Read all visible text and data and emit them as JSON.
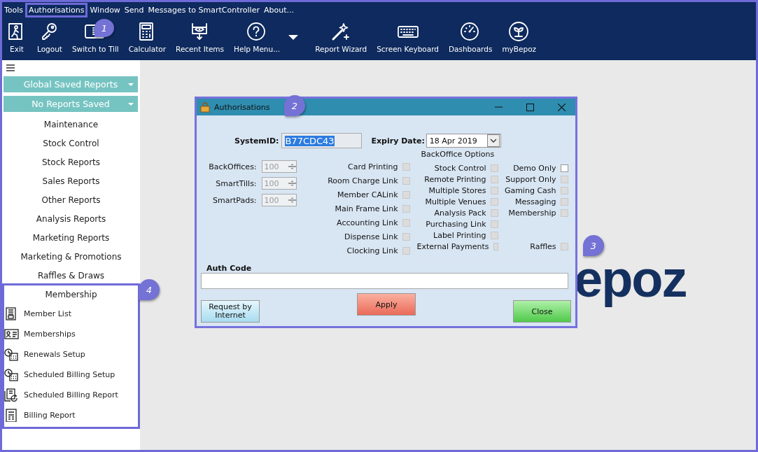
{
  "menu_bar": [
    {
      "label": "Tools",
      "highlighted": false
    },
    {
      "label": "Authorisations",
      "highlighted": true,
      "callout": "1"
    },
    {
      "label": "Window",
      "highlighted": false
    },
    {
      "label": "Send",
      "highlighted": false
    },
    {
      "label": "Messages to SmartController",
      "highlighted": false
    },
    {
      "label": "About...",
      "highlighted": false
    }
  ],
  "toolbar": [
    {
      "kind": "exit",
      "label": "Exit"
    },
    {
      "kind": "key",
      "label": "Logout"
    },
    {
      "kind": "till",
      "label": "Switch to Till"
    },
    {
      "kind": "calculator",
      "label": "Calculator"
    },
    {
      "kind": "recent",
      "label": "Recent Items"
    },
    {
      "kind": "help",
      "label": "Help Menu..."
    },
    {
      "kind": "caret"
    },
    {
      "kind": "wand",
      "label": "Report Wizard"
    },
    {
      "kind": "keyboard",
      "label": "Screen Keyboard"
    },
    {
      "kind": "gauge",
      "label": "Dashboards"
    },
    {
      "kind": "plant",
      "label": "myBepoz"
    }
  ],
  "sidebar": {
    "dropdowns": [
      "Global Saved Reports",
      "No Reports Saved"
    ],
    "items": [
      "Maintenance",
      "Stock Control",
      "Stock Reports",
      "Sales Reports",
      "Other Reports",
      "Analysis Reports",
      "Marketing Reports",
      "Marketing & Promotions",
      "Raffles & Draws"
    ],
    "section": {
      "title": "Membership",
      "highlighted": true,
      "callout": "4",
      "items": [
        {
          "kind": "list",
          "label": "Member List"
        },
        {
          "kind": "card",
          "label": "Memberships"
        },
        {
          "kind": "clock",
          "label": "Renewals Setup"
        },
        {
          "kind": "clock",
          "label": "Scheduled Billing Setup"
        },
        {
          "kind": "report",
          "label": "Scheduled Billing Report"
        },
        {
          "kind": "doc",
          "label": "Billing Report"
        }
      ]
    }
  },
  "background_logo": "epoz",
  "dialog": {
    "title": "Authorisations",
    "callout": "2",
    "system_id": {
      "label": "SystemID:",
      "value": "B77CDC43",
      "selected": true
    },
    "expiry": {
      "label": "Expiry Date:",
      "value": "18 Apr 2019"
    },
    "spinners": [
      {
        "label": "BackOffices:",
        "value": "100",
        "disabled": true
      },
      {
        "label": "SmartTills:",
        "value": "100",
        "disabled": true
      },
      {
        "label": "SmartPads:",
        "value": "100",
        "disabled": true
      }
    ],
    "links": [
      {
        "label": "Card Printing",
        "checked": false,
        "disabled": true
      },
      {
        "label": "Room Charge Link",
        "checked": false,
        "disabled": true
      },
      {
        "label": "Member CALink",
        "checked": false,
        "disabled": true
      },
      {
        "label": "Main Frame Link",
        "checked": false,
        "disabled": true
      },
      {
        "label": "Accounting Link",
        "checked": false,
        "disabled": true
      },
      {
        "label": "Dispense Link",
        "checked": false,
        "disabled": true
      },
      {
        "label": "Clocking Link",
        "checked": false,
        "disabled": true
      }
    ],
    "options": {
      "title": "BackOffice Options",
      "column_1": [
        {
          "label": "Stock Control",
          "checked": false,
          "disabled": true
        },
        {
          "label": "Remote Printing",
          "checked": false,
          "disabled": true
        },
        {
          "label": "Multiple Stores",
          "checked": false,
          "disabled": true
        },
        {
          "label": "Multiple Venues",
          "checked": false,
          "disabled": true
        },
        {
          "label": "Analysis Pack",
          "checked": false,
          "disabled": true
        },
        {
          "label": "Purchasing Link",
          "checked": false,
          "disabled": true
        },
        {
          "label": "Label Printing",
          "checked": false,
          "disabled": true
        },
        {
          "label": "External Payments",
          "checked": false,
          "disabled": true
        }
      ],
      "column_2": [
        {
          "label": "Demo Only",
          "checked": false,
          "disabled": false
        },
        {
          "label": "Support Only",
          "checked": false,
          "disabled": true
        },
        {
          "label": "Gaming Cash",
          "checked": false,
          "disabled": true
        },
        {
          "label": "Messaging",
          "checked": false,
          "disabled": true
        },
        {
          "label": "Membership",
          "checked": false,
          "disabled": true
        },
        {
          "label": "Raffles",
          "checked": false,
          "disabled": true,
          "callout": "3"
        }
      ]
    },
    "auth_code": {
      "label": "Auth Code"
    },
    "buttons": [
      {
        "kind": "request",
        "label": "Request by Internet"
      },
      {
        "kind": "apply",
        "label": "Apply"
      },
      {
        "kind": "close",
        "label": "Close"
      }
    ]
  }
}
